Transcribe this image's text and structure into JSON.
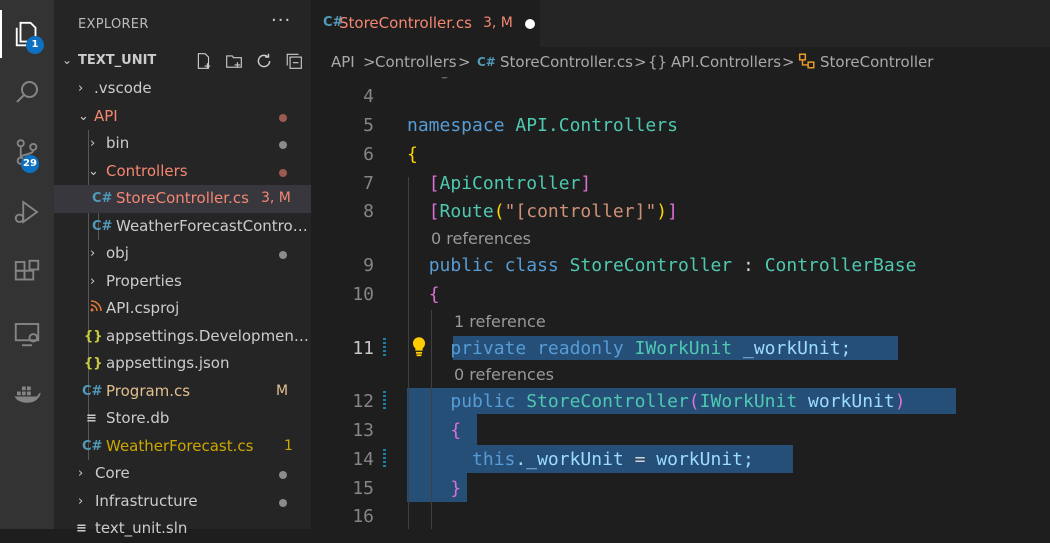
{
  "activity_bar": {
    "explorer_badge": "1",
    "source_control_badge": "29"
  },
  "sidebar": {
    "header": "EXPLORER",
    "more": "···",
    "section_title": "TEXT_UNIT",
    "items": [
      {
        "label": ".vscode",
        "type": "folder",
        "collapsed": true,
        "color": "#cccccc"
      },
      {
        "label": "API",
        "type": "folder",
        "collapsed": false,
        "color": "#f48771"
      },
      {
        "label": "bin",
        "type": "folder",
        "collapsed": true,
        "color": "#cccccc"
      },
      {
        "label": "Controllers",
        "type": "folder",
        "collapsed": false,
        "color": "#f48771"
      },
      {
        "label": "StoreController.cs",
        "type": "file",
        "icon": "C#",
        "color": "#f48771",
        "status": "3, M"
      },
      {
        "label": "WeatherForecastControll...",
        "type": "file",
        "icon": "C#",
        "color": "#cccccc"
      },
      {
        "label": "obj",
        "type": "folder",
        "collapsed": true,
        "color": "#cccccc"
      },
      {
        "label": "Properties",
        "type": "folder",
        "collapsed": true,
        "color": "#cccccc"
      },
      {
        "label": "API.csproj",
        "type": "file",
        "icon": "rss",
        "color": "#cccccc"
      },
      {
        "label": "appsettings.Development.j...",
        "type": "file",
        "icon": "{}",
        "color": "#cccccc"
      },
      {
        "label": "appsettings.json",
        "type": "file",
        "icon": "{}",
        "color": "#cccccc"
      },
      {
        "label": "Program.cs",
        "type": "file",
        "icon": "C#",
        "color": "#e2c08d",
        "status": "M"
      },
      {
        "label": "Store.db",
        "type": "file",
        "icon": "lines",
        "color": "#cccccc"
      },
      {
        "label": "WeatherForecast.cs",
        "type": "file",
        "icon": "C#",
        "color": "#cca700",
        "status": "1"
      },
      {
        "label": "Core",
        "type": "folder",
        "collapsed": true,
        "color": "#cccccc"
      },
      {
        "label": "Infrastructure",
        "type": "folder",
        "collapsed": true,
        "color": "#cccccc"
      },
      {
        "label": "text_unit.sln",
        "type": "file",
        "icon": "lines",
        "color": "#cccccc"
      }
    ]
  },
  "editor": {
    "tab": {
      "icon": "C#",
      "name": "StoreController.cs",
      "status": "3, M"
    },
    "breadcrumb": [
      "API",
      ">",
      "Controllers",
      ">",
      "C#",
      "StoreController.cs",
      ">",
      "{}",
      "API.Controllers",
      ">",
      "StoreController"
    ],
    "line_numbers": [
      "4",
      "5",
      "6",
      "7",
      "8",
      "9",
      "10",
      "11",
      "12",
      "13",
      "14",
      "15",
      "16"
    ],
    "codelens": [
      "0 references",
      "1 reference",
      "0 references"
    ],
    "code": {
      "l5_a": "namespace",
      "l5_b": "API.Controllers",
      "l6": "{",
      "l7_a": "[",
      "l7_b": "ApiController",
      "l7_c": "]",
      "l8_a": "[",
      "l8_b": "Route",
      "l8_c": "(",
      "l8_d": "\"[controller]\"",
      "l8_e": ")",
      "l8_f": "]",
      "l9_a": "public",
      "l9_b": "class",
      "l9_c": "StoreController",
      "l9_d": ":",
      "l9_e": "ControllerBase",
      "l10": "{",
      "l11_a": "private",
      "l11_b": "readonly",
      "l11_c": "IWorkUnit",
      "l11_d": "_workUnit;",
      "l12_a": "public",
      "l12_b": "StoreController",
      "l12_c": "(",
      "l12_d": "IWorkUnit",
      "l12_e": "workUnit",
      "l12_f": ")",
      "l13": "{",
      "l14_a": "this",
      "l14_b": "._workUnit",
      "l14_c": "=",
      "l14_d": "workUnit;",
      "l15": "}"
    }
  }
}
